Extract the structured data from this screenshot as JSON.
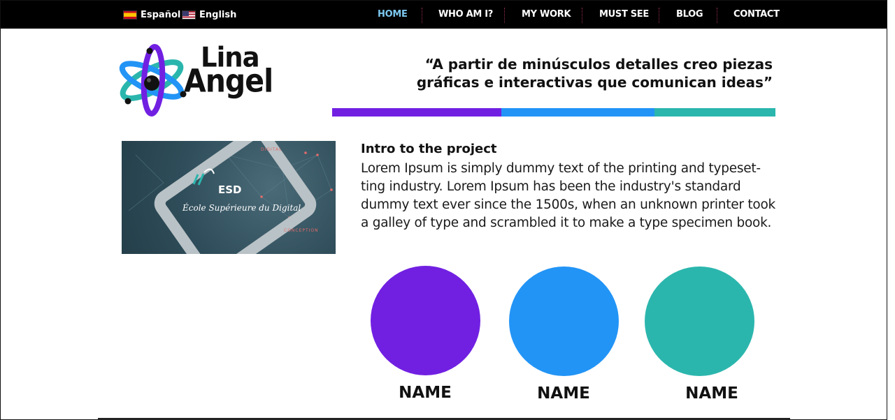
{
  "languages": [
    {
      "label": "Español",
      "flag": "spain-flag-icon"
    },
    {
      "label": "English",
      "flag": "us-flag-icon"
    }
  ],
  "nav": {
    "items": [
      {
        "label": "HOME",
        "active": true
      },
      {
        "label": "WHO AM I?",
        "active": false
      },
      {
        "label": "MY WORK",
        "active": false
      },
      {
        "label": "MUST SEE",
        "active": false
      },
      {
        "label": "BLOG",
        "active": false
      },
      {
        "label": "CONTACT",
        "active": false
      }
    ]
  },
  "logo": {
    "line1": "Lina",
    "line2": "Angel"
  },
  "quote": "“A partir de minúsculos detalles creo piezas gráficas e interactivas que comunican ideas”",
  "colors": {
    "purple": "#7120e2",
    "blue": "#2294f6",
    "teal": "#2bb6ad",
    "nav_active": "#7dc8f0",
    "topbar": "#000000"
  },
  "project_image": {
    "title": "ESD",
    "subtitle": "École Supérieure du Digital",
    "map_labels": [
      "DIGITAL",
      "CONCEPTION"
    ]
  },
  "intro": {
    "title": "Intro to the project",
    "body": "Lorem Ipsum is simply dummy text of the printing and typeset-ting industry. Lorem Ipsum has been the industry's standard dummy text ever since the 1500s, when an unknown printer took a galley of type and scrambled it to make a type specimen book."
  },
  "members": [
    {
      "name": "NAME",
      "color": "#7120e2"
    },
    {
      "name": "NAME",
      "color": "#2294f6"
    },
    {
      "name": "NAME",
      "color": "#2bb6ad"
    }
  ]
}
